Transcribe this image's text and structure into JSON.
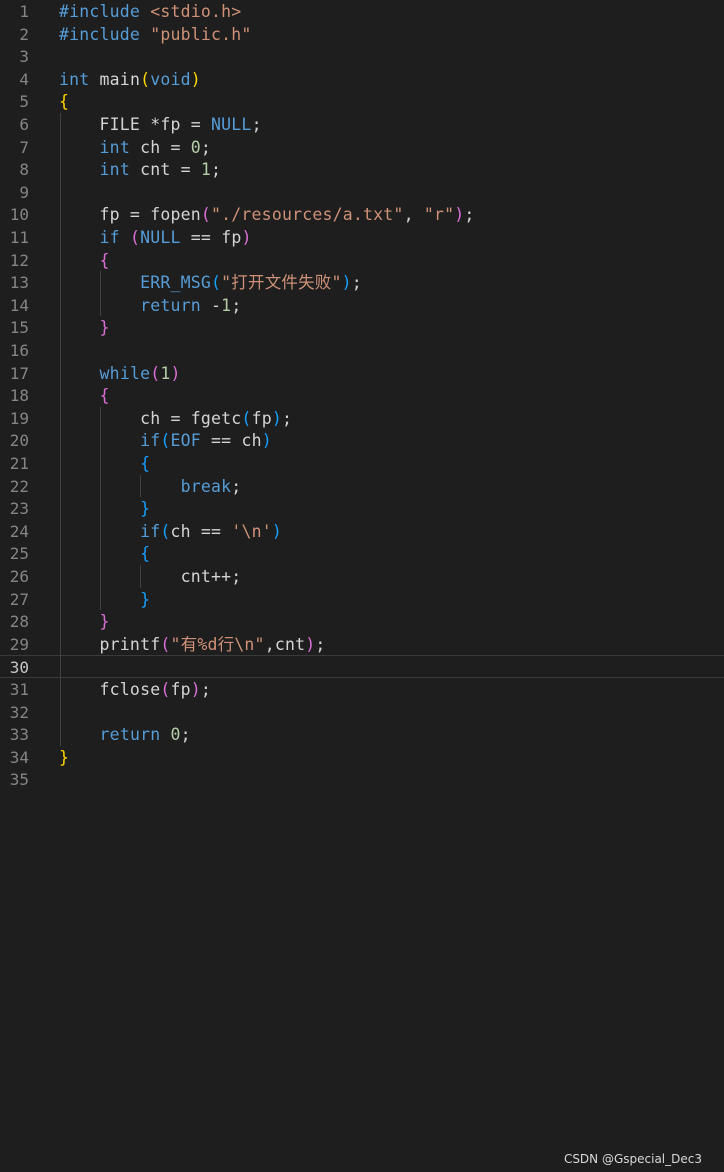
{
  "editor": {
    "active_line": 30,
    "lines": [
      [
        [
          "#include ",
          "pp"
        ],
        [
          "<stdio.h>",
          "inc"
        ]
      ],
      [
        [
          "#include ",
          "pp"
        ],
        [
          "\"public.h\"",
          "inc"
        ]
      ],
      [],
      [
        [
          "int",
          "kw"
        ],
        [
          " main",
          ""
        ],
        [
          "(",
          "b1"
        ],
        [
          "void",
          "kw"
        ],
        [
          ")",
          "b1"
        ]
      ],
      [
        [
          "{",
          "b1"
        ]
      ],
      [
        [
          "    FILE *fp = ",
          ""
        ],
        [
          "NULL",
          "mac"
        ],
        [
          ";",
          ""
        ]
      ],
      [
        [
          "    ",
          ""
        ],
        [
          "int",
          "kw"
        ],
        [
          " ch = ",
          ""
        ],
        [
          "0",
          "num"
        ],
        [
          ";",
          ""
        ]
      ],
      [
        [
          "    ",
          ""
        ],
        [
          "int",
          "kw"
        ],
        [
          " cnt = ",
          ""
        ],
        [
          "1",
          "num"
        ],
        [
          ";",
          ""
        ]
      ],
      [],
      [
        [
          "    fp = fopen",
          ""
        ],
        [
          "(",
          "b2"
        ],
        [
          "\"./resources/a.txt\"",
          "str"
        ],
        [
          ", ",
          ""
        ],
        [
          "\"r\"",
          "str"
        ],
        [
          ")",
          "b2"
        ],
        [
          ";",
          ""
        ]
      ],
      [
        [
          "    ",
          ""
        ],
        [
          "if",
          "kw"
        ],
        [
          " ",
          ""
        ],
        [
          "(",
          "b2"
        ],
        [
          "NULL",
          "mac"
        ],
        [
          " == fp",
          ""
        ],
        [
          ")",
          "b2"
        ]
      ],
      [
        [
          "    ",
          ""
        ],
        [
          "{",
          "b2"
        ]
      ],
      [
        [
          "        ",
          ""
        ],
        [
          "ERR_MSG",
          "mac"
        ],
        [
          "(",
          "b3"
        ],
        [
          "\"打开文件失败\"",
          "str"
        ],
        [
          ")",
          "b3"
        ],
        [
          ";",
          ""
        ]
      ],
      [
        [
          "        ",
          ""
        ],
        [
          "return",
          "kw"
        ],
        [
          " -",
          ""
        ],
        [
          "1",
          "num"
        ],
        [
          ";",
          ""
        ]
      ],
      [
        [
          "    ",
          ""
        ],
        [
          "}",
          "b2"
        ]
      ],
      [],
      [
        [
          "    ",
          ""
        ],
        [
          "while",
          "kw"
        ],
        [
          "(",
          "b2"
        ],
        [
          "1",
          "num"
        ],
        [
          ")",
          "b2"
        ]
      ],
      [
        [
          "    ",
          ""
        ],
        [
          "{",
          "b2"
        ]
      ],
      [
        [
          "        ch = fgetc",
          ""
        ],
        [
          "(",
          "b3"
        ],
        [
          "fp",
          ""
        ],
        [
          ")",
          "b3"
        ],
        [
          ";",
          ""
        ]
      ],
      [
        [
          "        ",
          ""
        ],
        [
          "if",
          "kw"
        ],
        [
          "(",
          "b3"
        ],
        [
          "EOF",
          "mac"
        ],
        [
          " == ch",
          ""
        ],
        [
          ")",
          "b3"
        ]
      ],
      [
        [
          "        ",
          ""
        ],
        [
          "{",
          "b3"
        ]
      ],
      [
        [
          "            ",
          ""
        ],
        [
          "break",
          "kw"
        ],
        [
          ";",
          ""
        ]
      ],
      [
        [
          "        ",
          ""
        ],
        [
          "}",
          "b3"
        ]
      ],
      [
        [
          "        ",
          ""
        ],
        [
          "if",
          "kw"
        ],
        [
          "(",
          "b3"
        ],
        [
          "ch == ",
          ""
        ],
        [
          "'\\n'",
          "str"
        ],
        [
          ")",
          "b3"
        ]
      ],
      [
        [
          "        ",
          ""
        ],
        [
          "{",
          "b3"
        ]
      ],
      [
        [
          "            cnt++;",
          ""
        ]
      ],
      [
        [
          "        ",
          ""
        ],
        [
          "}",
          "b3"
        ]
      ],
      [
        [
          "    ",
          ""
        ],
        [
          "}",
          "b2"
        ]
      ],
      [
        [
          "    printf",
          ""
        ],
        [
          "(",
          "b2"
        ],
        [
          "\"有%d行\\n\"",
          "str"
        ],
        [
          ",cnt",
          ""
        ],
        [
          ")",
          "b2"
        ],
        [
          ";",
          ""
        ]
      ],
      [],
      [
        [
          "    fclose",
          ""
        ],
        [
          "(",
          "b2"
        ],
        [
          "fp",
          ""
        ],
        [
          ")",
          "b2"
        ],
        [
          ";",
          ""
        ]
      ],
      [],
      [
        [
          "    ",
          ""
        ],
        [
          "return",
          "kw"
        ],
        [
          " ",
          ""
        ],
        [
          "0",
          "num"
        ],
        [
          ";",
          ""
        ]
      ],
      [
        [
          "}",
          "b1"
        ]
      ],
      []
    ]
  },
  "watermark": "CSDN @Gspecial_Dec3"
}
